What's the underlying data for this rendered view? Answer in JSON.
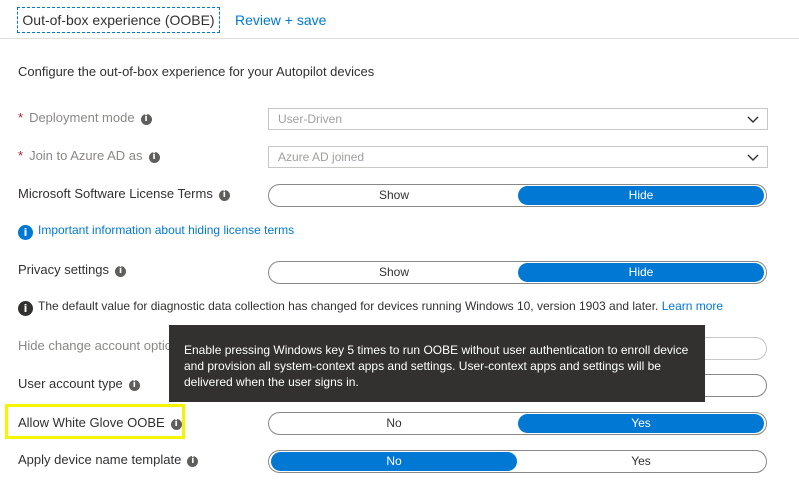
{
  "tabs": {
    "active": "Out-of-box experience (OOBE)",
    "review": "Review + save"
  },
  "description": "Configure the out-of-box experience for your Autopilot devices",
  "fields": {
    "deployment_mode": {
      "label": "Deployment mode",
      "required": "*",
      "value": "User-Driven"
    },
    "join_azure": {
      "label": "Join to Azure AD as",
      "required": "*",
      "value": "Azure AD joined"
    },
    "license_terms": {
      "label": "Microsoft Software License Terms",
      "left": "Show",
      "right": "Hide",
      "selected": "right"
    },
    "license_link": "Important information about hiding license terms",
    "privacy": {
      "label": "Privacy settings",
      "left": "Show",
      "right": "Hide",
      "selected": "right"
    },
    "privacy_note": "The default value for diagnostic data collection has changed for devices running Windows 10, version 1903 and later.",
    "privacy_note_link": "Learn more",
    "hide_change_account": {
      "label": "Hide change account optio"
    },
    "user_account_type": {
      "label": "User account type"
    },
    "white_glove": {
      "label": "Allow White Glove OOBE",
      "left": "No",
      "right": "Yes",
      "selected": "right"
    },
    "device_name": {
      "label": "Apply device name template",
      "left": "No",
      "right": "Yes",
      "selected": "left"
    }
  },
  "tooltip": {
    "text": "Enable pressing Windows key 5 times to run OOBE without user authentication to enroll device and provision all system-context apps and settings. User-context apps and settings will be delivered when the user signs in."
  },
  "icons": {
    "info": "info-icon",
    "chevron": "chevron-down-icon"
  },
  "colors": {
    "accent": "#0078d4",
    "highlight": "#f5f500",
    "tooltip_bg": "#323130",
    "required": "#a4262c"
  }
}
